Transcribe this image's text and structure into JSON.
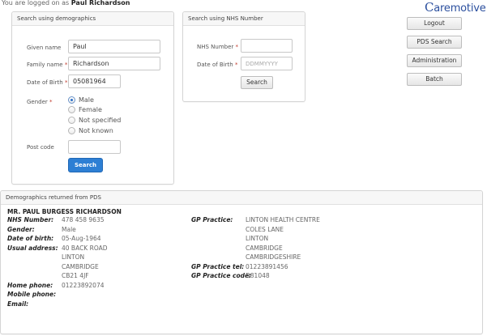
{
  "session": {
    "logged_prefix": "You are logged on as",
    "user": "Paul Richardson"
  },
  "logo": {
    "c": "C",
    "rest": "aremotive"
  },
  "demographics_search": {
    "title": "Search using demographics",
    "given_name_label": "Given name",
    "given_name_value": "Paul",
    "family_name_label": "Family name",
    "family_name_value": "Richardson",
    "dob_label": "Date of Birth",
    "dob_value": "05081964",
    "gender_label": "Gender",
    "gender_options": [
      "Male",
      "Female",
      "Not specified",
      "Not known"
    ],
    "gender_selected": "Male",
    "postcode_label": "Post code",
    "postcode_value": "",
    "search_button": "Search",
    "required_mark": "*"
  },
  "nhs_search": {
    "title": "Search using NHS Number",
    "nhs_label": "NHS Number",
    "nhs_value": "",
    "dob_label": "Date of Birth",
    "dob_placeholder": "DDMMYYYY",
    "search_button": "Search",
    "required_mark": "*"
  },
  "side_buttons": {
    "logout": "Logout",
    "pds_search": "PDS Search",
    "administration": "Administration",
    "batch": "Batch"
  },
  "results": {
    "title": "Demographics returned from PDS",
    "name": "MR. PAUL BURGESS RICHARDSON",
    "nhs_number_label": "NHS Number:",
    "nhs_number": "478 458 9635",
    "gender_label": "Gender:",
    "gender": "Male",
    "dob_label": "Date of birth:",
    "dob": "05-Aug-1964",
    "address_label": "Usual address:",
    "address": [
      "40 BACK ROAD",
      "LINTON",
      "CAMBRIDGE",
      "CB21 4JF"
    ],
    "home_phone_label": "Home phone:",
    "home_phone": "01223892074",
    "mobile_phone_label": "Mobile phone:",
    "mobile_phone": "",
    "email_label": "Email:",
    "email": "",
    "gp_practice_label": "GP Practice:",
    "gp_practice": [
      "LINTON HEALTH CENTRE",
      "COLES LANE",
      "LINTON",
      "CAMBRIDGE",
      "CAMBRIDGESHIRE"
    ],
    "gp_tel_label": "GP Practice tel:",
    "gp_tel": "01223891456",
    "gp_code_label": "GP Practice code:",
    "gp_code": "D81048"
  }
}
